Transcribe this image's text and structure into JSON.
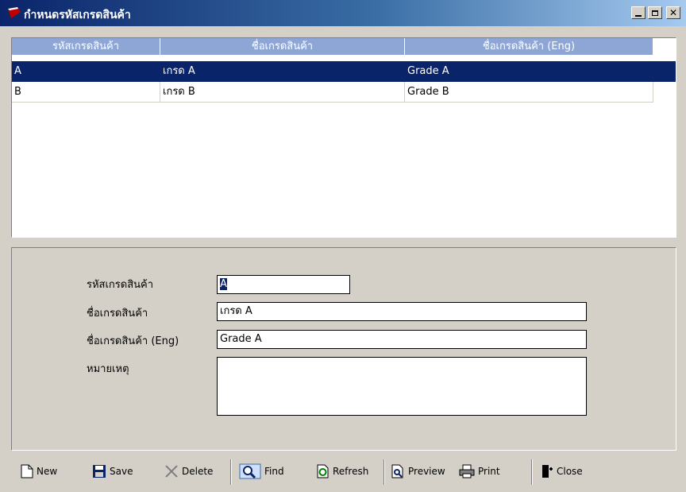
{
  "window": {
    "title": "กำหนดรหัสเกรดสินค้า"
  },
  "grid": {
    "columns": [
      "รหัสเกรดสินค้า",
      "ชื่อเกรดสินค้า",
      "ชื่อเกรดสินค้า (Eng)"
    ],
    "rows": [
      [
        "A",
        "เกรด A",
        "Grade A"
      ],
      [
        "B",
        "เกรด B",
        "Grade B"
      ]
    ],
    "selected_row": 0
  },
  "form": {
    "code_label": "รหัสเกรดสินค้า",
    "code_value": "A",
    "name_label": "ชื่อเกรดสินค้า",
    "name_value": "เกรด A",
    "name_eng_label": "ชื่อเกรดสินค้า (Eng)",
    "name_eng_value": "Grade A",
    "remark_label": "หมายเหตุ",
    "remark_value": ""
  },
  "toolbar": {
    "new_label": "New",
    "save_label": "Save",
    "delete_label": "Delete",
    "find_label": "Find",
    "refresh_label": "Refresh",
    "preview_label": "Preview",
    "print_label": "Print",
    "close_label": "Close"
  },
  "colors": {
    "title_gradient_start": "#0a246a",
    "title_gradient_end": "#a6caf0",
    "header_bg": "#8ea6d6",
    "selection_bg": "#0a246a",
    "window_bg": "#d4d0c8"
  }
}
